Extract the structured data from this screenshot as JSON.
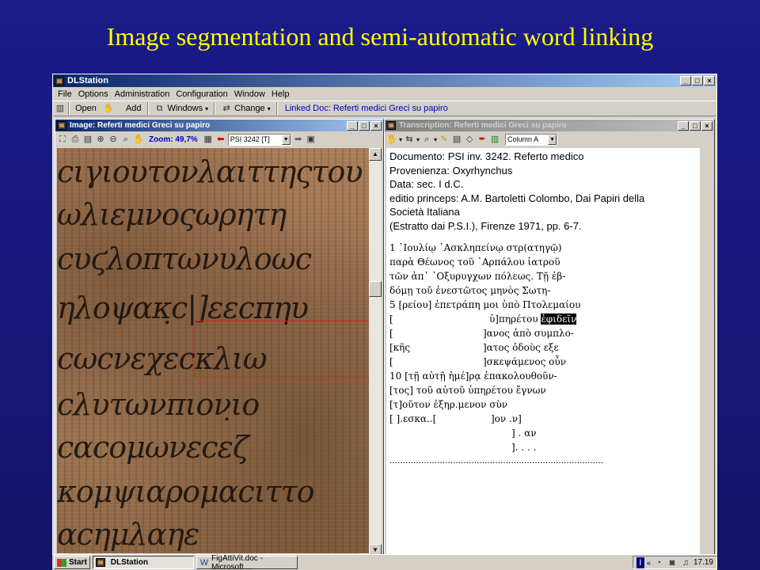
{
  "slide": {
    "title": "Image segmentation and semi-automatic word linking"
  },
  "app": {
    "title": "DLStation",
    "menu": [
      "File",
      "Options",
      "Administration",
      "Configuration",
      "Window",
      "Help"
    ],
    "toolbar": {
      "open": "Open",
      "add": "Add",
      "windows": "Windows",
      "change": "Change",
      "linked_doc": "Linked Doc: Referti medici Greci su papiro"
    }
  },
  "image_window": {
    "title": "Image: Referti medici Greci su papiro",
    "zoom": "Zoom: 49,7%",
    "doc_select": "PSI 3242 [T]",
    "papyrus_lines": [
      "ϲιγιουτονλαιττηςτου",
      "ωλιεμνοςωρητη",
      "ϲυϛλοπτωνυλοωϲ",
      "ηλοψακ̣ϲ|]εεϲπηυ",
      "ϲωϲνεχεϲκλιω",
      "ϲλυτωνπιον̣ιο",
      "ϲαϲομωνεϲεζ",
      "κομψιαρομαϲιττο",
      "αϲημλαηε"
    ]
  },
  "transcription_window": {
    "title": "Transcription: Referti medici Greci su papiro",
    "column_select": "Column A",
    "header": [
      "Documento: PSI inv. 3242. Referto medico",
      "Provenienza: Oxyrhynchus",
      "Data: sec. I d.C.",
      "editio princeps:  A.M. Bartoletti Colombo, Dai Papiri della",
      "Società Italiana",
      "(Estratto dai P.S.I.), Firenze 1971, pp. 6-7."
    ],
    "lines": [
      {
        "a": "1 ᾽Ιουλίῳ ᾽Ασκληπείνῳ στρ(ατηγῷ)"
      },
      {
        "a": "παρὰ Θέωνος τοῦ ῾Αρπάλου ἰατροῦ"
      },
      {
        "a": "τῶν ἀπ᾽ ᾽Οξυρυγχων πόλεως. Τῇ ἐβ-"
      },
      {
        "a": "δόμῃ τοῦ ἐνεστῶτος μηνὸς Σωτη-"
      },
      {
        "a": "5 [ρείου] ἐπετράπη μοι ὑπὸ Πτολεμαίου"
      },
      {
        "a": "[",
        "b": "ὑ]πηρέτου",
        "hl": "ἐφιδεῖν"
      },
      {
        "a": "[",
        "b": "]ανος ἀπὸ συμπλο-"
      },
      {
        "a": "[κῆς",
        "b": "]ατος ὁδοὺς εξε"
      },
      {
        "a": "[",
        "b": "]σκεψάμενος οὖν"
      },
      {
        "a": "10 [τῇ αὐτῇ ἡμέ]ρᾳ ἐπακολουθοῦν-"
      },
      {
        "a": "[τος] τοῦ αὐτοῦ ὑπηρέτου ἔγνων"
      },
      {
        "a": "[τ]οῦτον ἐξηρ.μενον σὺν"
      },
      {
        "a": "[      ].εσκα..[",
        "b": "]ον .ν]"
      },
      {
        "b2": "] .  αν"
      },
      {
        "b2": "]. .  . ."
      }
    ],
    "divider": "................................................................................."
  },
  "taskbar": {
    "start": "Start",
    "task1": "DLStation",
    "task2": "FigAttiVit.doc - Microsoft ...",
    "time": "17.19"
  }
}
